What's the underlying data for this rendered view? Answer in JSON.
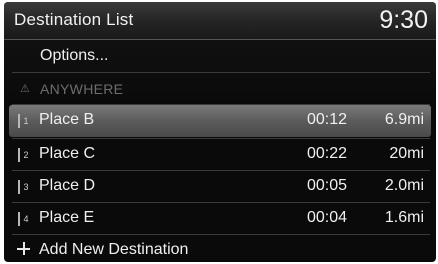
{
  "header": {
    "title": "Destination List",
    "clock": "9:30"
  },
  "menu": {
    "options_label": "Options...",
    "anywhere_label": "ANYWHERE",
    "anywhere_icon": "warning-triangle-icon"
  },
  "destinations": [
    {
      "num": "1",
      "name": "Place B",
      "time": "00:12",
      "distance": "6.9mi",
      "selected": true
    },
    {
      "num": "2",
      "name": "Place C",
      "time": "00:22",
      "distance": "20mi"
    },
    {
      "num": "3",
      "name": "Place D",
      "time": "00:05",
      "distance": "2.0mi"
    },
    {
      "num": "4",
      "name": "Place E",
      "time": "00:04",
      "distance": "1.6mi"
    }
  ],
  "footer": {
    "add_label": "Add New Destination",
    "add_icon": "plus-icon"
  },
  "colors": {
    "background": "#0b0b0b",
    "highlight": "#5b5b5b",
    "text": "#f0f0f0",
    "disabled_text": "#6d6d6d"
  }
}
